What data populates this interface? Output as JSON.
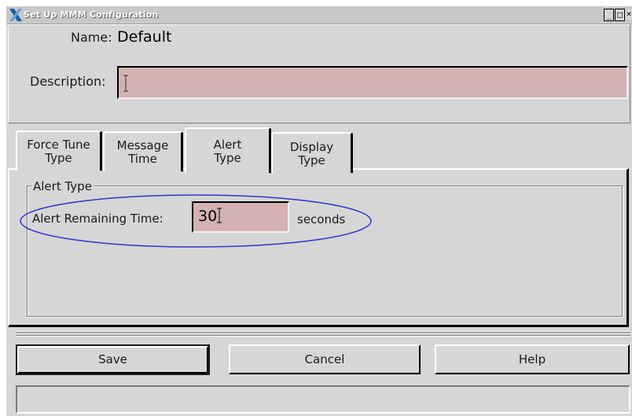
{
  "window": {
    "title": "Set Up MMM Configuration",
    "controls": {
      "minimize": "_",
      "maximize": "□",
      "close": "×"
    }
  },
  "form": {
    "name_label": "Name:",
    "name_value": "Default",
    "description_label": "Description:",
    "description_value": ""
  },
  "tabs": [
    {
      "line1": "Force Tune",
      "line2": "Type",
      "active": false
    },
    {
      "line1": "Message",
      "line2": "Time",
      "active": false
    },
    {
      "line1": "Alert",
      "line2": "Type",
      "active": true
    },
    {
      "line1": "Display",
      "line2": "Type",
      "active": false
    }
  ],
  "alert_type": {
    "group_title": "Alert Type",
    "remaining_time_label": "Alert Remaining Time:",
    "remaining_time_value": "30",
    "unit_label": "seconds"
  },
  "buttons": {
    "save": "Save",
    "cancel": "Cancel",
    "help": "Help"
  },
  "status_bar": {
    "text": ""
  },
  "colors": {
    "window_bg": "#d6d6d6",
    "input_bg": "#d4b2b2",
    "annotation_ellipse": "#3333cc"
  },
  "icons": {
    "app": "x-logo-icon",
    "text_cursor": "ibeam-cursor-icon"
  }
}
